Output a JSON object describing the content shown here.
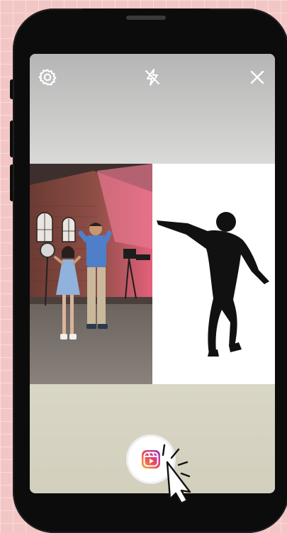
{
  "camera": {
    "settings_icon": "gear-icon",
    "flash_icon": "flash-off-icon",
    "close_icon": "close-icon",
    "record_icon": "reels-icon"
  },
  "colors": {
    "reels_gradient": [
      "#f6b23a",
      "#ee4b56",
      "#c53a9f",
      "#7a3fd0"
    ],
    "silhouette": "#111111"
  }
}
